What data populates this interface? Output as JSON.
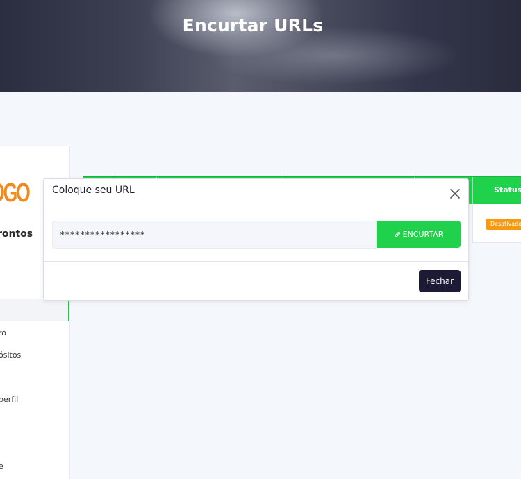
{
  "header": {
    "title": "Encurtar URLs"
  },
  "sidebar": {
    "logo_text": "OGO",
    "brand_name": "rontos",
    "items": [
      {
        "label": "ro"
      },
      {
        "label": "ósitos"
      },
      {
        "label": "perfil"
      },
      {
        "label": "e"
      }
    ]
  },
  "table": {
    "headers": {
      "status": "Status"
    },
    "rows": [
      {
        "status_badge": "Desativado"
      }
    ]
  },
  "modal": {
    "title": "Coloque seu URL",
    "url_value": "*****************",
    "encurtar_label": "ENCURTAR",
    "fechar_label": "Fechar"
  },
  "colors": {
    "accent_green": "#1fd14b",
    "badge_orange": "#f59a12",
    "dark_button": "#1d1a36",
    "logo_orange": "#f18a1c"
  },
  "icons": [
    "close-icon",
    "link-icon"
  ]
}
